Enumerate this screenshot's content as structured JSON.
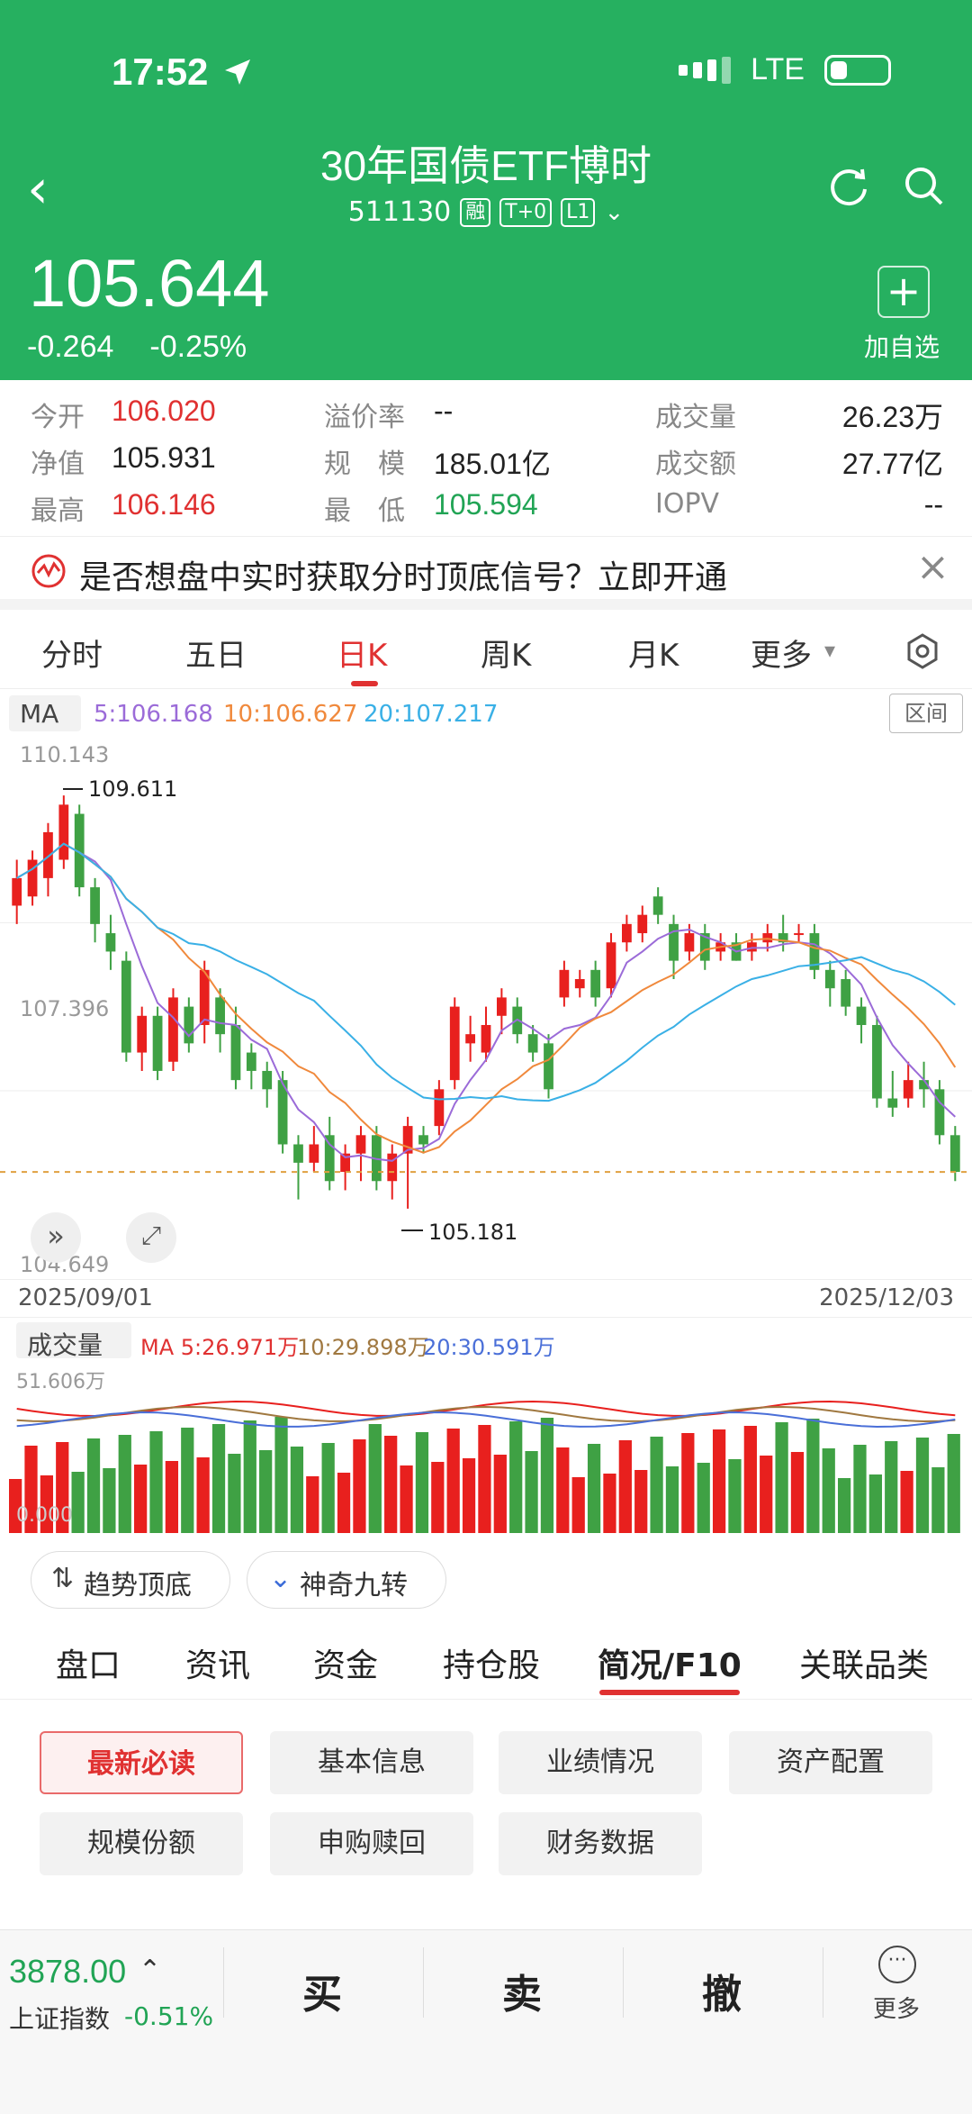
{
  "status_bar": {
    "time": "17:52",
    "network": "LTE"
  },
  "header": {
    "title": "30年国债ETF博时",
    "code": "511130",
    "tags": [
      "融",
      "T+0",
      "L1"
    ],
    "price": "105.644",
    "change": "-0.264",
    "change_pct": "-0.25%",
    "add_label": "加自选",
    "colors": {
      "bg": "#26b060"
    }
  },
  "quote": {
    "open_label": "今开",
    "open": "106.020",
    "nav_label": "净值",
    "nav": "105.931",
    "high_label": "最高",
    "high": "106.146",
    "premium_label": "溢价率",
    "premium": "--",
    "scale_label": "规　模",
    "scale": "185.01亿",
    "low_label": "最　低",
    "low": "105.594",
    "volume_label": "成交量",
    "volume": "26.23万",
    "amount_label": "成交额",
    "amount": "27.77亿",
    "iopv_label": "IOPV",
    "iopv": "--"
  },
  "banner": {
    "text": "是否想盘中实时获取分时顶底信号？立即开通"
  },
  "chart_tabs": [
    "分时",
    "五日",
    "日K",
    "周K",
    "月K",
    "更多"
  ],
  "chart_tabs_active": "日K",
  "ma_legend": {
    "label": "MA",
    "ma5": "5:106.168",
    "ma10": "10:106.627",
    "ma20": "20:107.217",
    "range_btn": "区间"
  },
  "kline_axis": {
    "top": "110.143",
    "mid": "107.396",
    "bottom": "104.649",
    "hi_mark": "109.611",
    "lo_mark": "105.181",
    "date_start": "2025/09/01",
    "date_end": "2025/12/03"
  },
  "vol_legend": {
    "label": "成交量",
    "ma5": "MA 5:26.971万",
    "ma10": "10:29.898万",
    "ma20": "20:30.591万",
    "top": "51.606万",
    "bottom": "0.000"
  },
  "indicator_buttons": [
    "趋势顶底",
    "神奇九转"
  ],
  "info_tabs": [
    "盘口",
    "资讯",
    "资金",
    "持仓股",
    "简况/F10",
    "关联品类"
  ],
  "info_tabs_active": "简况/F10",
  "f10_buttons": [
    "最新必读",
    "基本信息",
    "业绩情况",
    "资产配置",
    "规模份额",
    "申购赎回",
    "财务数据"
  ],
  "bottom_bar": {
    "index_value": "3878.00",
    "index_name": "上证指数",
    "index_pct": "-0.51%",
    "buy": "买",
    "sell": "卖",
    "cancel": "撤",
    "more": "更多"
  },
  "chart_data": {
    "type": "candlestick",
    "x_range": [
      "2025/09/01",
      "2025/12/03"
    ],
    "y_range": [
      104.649,
      110.143
    ],
    "candles": [
      {
        "o": 108.5,
        "c": 108.8,
        "h": 109.0,
        "l": 108.3
      },
      {
        "o": 108.6,
        "c": 109.0,
        "h": 109.1,
        "l": 108.5
      },
      {
        "o": 108.8,
        "c": 109.3,
        "h": 109.4,
        "l": 108.6
      },
      {
        "o": 109.0,
        "c": 109.6,
        "h": 109.7,
        "l": 108.9
      },
      {
        "o": 109.5,
        "c": 108.7,
        "h": 109.6,
        "l": 108.6
      },
      {
        "o": 108.7,
        "c": 108.3,
        "h": 108.8,
        "l": 108.1
      },
      {
        "o": 108.2,
        "c": 108.0,
        "h": 108.4,
        "l": 107.8
      },
      {
        "o": 107.9,
        "c": 106.9,
        "h": 108.0,
        "l": 106.8
      },
      {
        "o": 106.9,
        "c": 107.3,
        "h": 107.4,
        "l": 106.7
      },
      {
        "o": 107.3,
        "c": 106.7,
        "h": 107.4,
        "l": 106.6
      },
      {
        "o": 106.8,
        "c": 107.5,
        "h": 107.6,
        "l": 106.7
      },
      {
        "o": 107.4,
        "c": 107.0,
        "h": 107.5,
        "l": 106.9
      },
      {
        "o": 107.2,
        "c": 107.8,
        "h": 107.9,
        "l": 107.0
      },
      {
        "o": 107.5,
        "c": 107.1,
        "h": 107.6,
        "l": 106.9
      },
      {
        "o": 107.2,
        "c": 106.6,
        "h": 107.4,
        "l": 106.5
      },
      {
        "o": 106.9,
        "c": 106.7,
        "h": 107.0,
        "l": 106.5
      },
      {
        "o": 106.7,
        "c": 106.5,
        "h": 106.8,
        "l": 106.3
      },
      {
        "o": 106.6,
        "c": 105.9,
        "h": 106.7,
        "l": 105.8
      },
      {
        "o": 105.9,
        "c": 105.7,
        "h": 106.0,
        "l": 105.3
      },
      {
        "o": 105.7,
        "c": 105.9,
        "h": 106.1,
        "l": 105.6
      },
      {
        "o": 106.0,
        "c": 105.5,
        "h": 106.2,
        "l": 105.4
      },
      {
        "o": 105.6,
        "c": 105.8,
        "h": 105.9,
        "l": 105.4
      },
      {
        "o": 105.8,
        "c": 106.0,
        "h": 106.1,
        "l": 105.5
      },
      {
        "o": 106.0,
        "c": 105.5,
        "h": 106.1,
        "l": 105.4
      },
      {
        "o": 105.5,
        "c": 105.8,
        "h": 105.9,
        "l": 105.3
      },
      {
        "o": 105.8,
        "c": 106.1,
        "h": 106.2,
        "l": 105.2
      },
      {
        "o": 106.0,
        "c": 105.9,
        "h": 106.1,
        "l": 105.8
      },
      {
        "o": 106.1,
        "c": 106.5,
        "h": 106.6,
        "l": 106.0
      },
      {
        "o": 106.6,
        "c": 107.4,
        "h": 107.5,
        "l": 106.5
      },
      {
        "o": 107.0,
        "c": 107.1,
        "h": 107.3,
        "l": 106.8
      },
      {
        "o": 106.9,
        "c": 107.2,
        "h": 107.4,
        "l": 106.8
      },
      {
        "o": 107.3,
        "c": 107.5,
        "h": 107.6,
        "l": 107.1
      },
      {
        "o": 107.4,
        "c": 107.1,
        "h": 107.5,
        "l": 107.0
      },
      {
        "o": 107.1,
        "c": 106.9,
        "h": 107.2,
        "l": 106.8
      },
      {
        "o": 107.0,
        "c": 106.5,
        "h": 107.1,
        "l": 106.4
      },
      {
        "o": 107.5,
        "c": 107.8,
        "h": 107.9,
        "l": 107.4
      },
      {
        "o": 107.6,
        "c": 107.7,
        "h": 107.8,
        "l": 107.5
      },
      {
        "o": 107.8,
        "c": 107.5,
        "h": 107.9,
        "l": 107.4
      },
      {
        "o": 107.6,
        "c": 108.1,
        "h": 108.2,
        "l": 107.5
      },
      {
        "o": 108.1,
        "c": 108.3,
        "h": 108.4,
        "l": 108.0
      },
      {
        "o": 108.2,
        "c": 108.4,
        "h": 108.5,
        "l": 108.1
      },
      {
        "o": 108.6,
        "c": 108.4,
        "h": 108.7,
        "l": 108.3
      },
      {
        "o": 108.3,
        "c": 107.9,
        "h": 108.4,
        "l": 107.7
      },
      {
        "o": 108.0,
        "c": 108.2,
        "h": 108.3,
        "l": 107.9
      },
      {
        "o": 108.2,
        "c": 107.9,
        "h": 108.3,
        "l": 107.8
      },
      {
        "o": 108.0,
        "c": 108.1,
        "h": 108.2,
        "l": 107.9
      },
      {
        "o": 108.1,
        "c": 107.9,
        "h": 108.2,
        "l": 107.9
      },
      {
        "o": 108.0,
        "c": 108.1,
        "h": 108.2,
        "l": 107.9
      },
      {
        "o": 108.1,
        "c": 108.2,
        "h": 108.3,
        "l": 108.0
      },
      {
        "o": 108.2,
        "c": 108.1,
        "h": 108.4,
        "l": 108.0
      },
      {
        "o": 108.2,
        "c": 108.2,
        "h": 108.3,
        "l": 108.1
      },
      {
        "o": 108.2,
        "c": 107.8,
        "h": 108.3,
        "l": 107.7
      },
      {
        "o": 107.8,
        "c": 107.6,
        "h": 107.9,
        "l": 107.4
      },
      {
        "o": 107.7,
        "c": 107.4,
        "h": 107.8,
        "l": 107.3
      },
      {
        "o": 107.4,
        "c": 107.2,
        "h": 107.5,
        "l": 107.0
      },
      {
        "o": 107.2,
        "c": 106.4,
        "h": 107.3,
        "l": 106.3
      },
      {
        "o": 106.4,
        "c": 106.3,
        "h": 106.7,
        "l": 106.2
      },
      {
        "o": 106.4,
        "c": 106.6,
        "h": 106.8,
        "l": 106.3
      },
      {
        "o": 106.6,
        "c": 106.5,
        "h": 106.8,
        "l": 106.3
      },
      {
        "o": 106.5,
        "c": 106.0,
        "h": 106.6,
        "l": 105.9
      },
      {
        "o": 106.0,
        "c": 105.6,
        "h": 106.1,
        "l": 105.5
      }
    ],
    "volume_range": [
      0,
      51.606
    ],
    "volume_unit": "万"
  }
}
